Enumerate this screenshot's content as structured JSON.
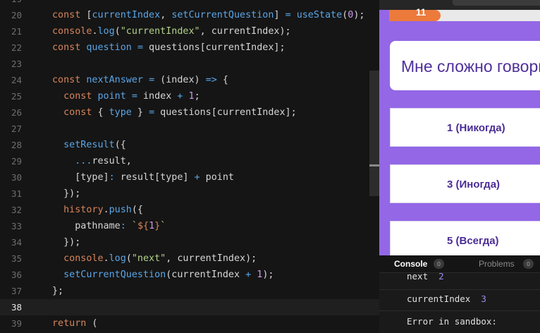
{
  "editor": {
    "top_partial_line": "19",
    "line_numbers": [
      "20",
      "21",
      "22",
      "23",
      "24",
      "25",
      "26",
      "27",
      "28",
      "29",
      "30",
      "31",
      "32",
      "33",
      "34",
      "35",
      "36",
      "37",
      "38",
      "39"
    ],
    "lines": [
      [
        [
          "kw",
          "const"
        ],
        [
          "pl",
          " ["
        ],
        [
          "fn",
          "currentIndex"
        ],
        [
          "pl",
          ", "
        ],
        [
          "fn",
          "setCurrentQuestion"
        ],
        [
          "pl",
          "] "
        ],
        [
          "op",
          "="
        ],
        [
          "pl",
          " "
        ],
        [
          "fn",
          "useState"
        ],
        [
          "pl",
          "("
        ],
        [
          "num",
          "0"
        ],
        [
          "pl",
          ");"
        ]
      ],
      [
        [
          "kw",
          "console"
        ],
        [
          "pl",
          "."
        ],
        [
          "fn",
          "log"
        ],
        [
          "pl",
          "("
        ],
        [
          "str",
          "\"currentIndex\""
        ],
        [
          "pl",
          ", currentIndex);"
        ]
      ],
      [
        [
          "kw",
          "const"
        ],
        [
          "pl",
          " "
        ],
        [
          "fn",
          "question"
        ],
        [
          "pl",
          " "
        ],
        [
          "op",
          "="
        ],
        [
          "pl",
          " questions[currentIndex];"
        ]
      ],
      [],
      [
        [
          "kw",
          "const"
        ],
        [
          "pl",
          " "
        ],
        [
          "fn",
          "nextAnswer"
        ],
        [
          "pl",
          " "
        ],
        [
          "op",
          "="
        ],
        [
          "pl",
          " (index) "
        ],
        [
          "op",
          "=>"
        ],
        [
          "pl",
          " {"
        ]
      ],
      [
        [
          "pl",
          "  "
        ],
        [
          "kw",
          "const"
        ],
        [
          "pl",
          " "
        ],
        [
          "fn",
          "point"
        ],
        [
          "pl",
          " "
        ],
        [
          "op",
          "="
        ],
        [
          "pl",
          " index "
        ],
        [
          "op",
          "+"
        ],
        [
          "pl",
          " "
        ],
        [
          "num",
          "1"
        ],
        [
          "pl",
          ";"
        ]
      ],
      [
        [
          "pl",
          "  "
        ],
        [
          "kw",
          "const"
        ],
        [
          "pl",
          " { "
        ],
        [
          "fn",
          "type"
        ],
        [
          "pl",
          " } "
        ],
        [
          "op",
          "="
        ],
        [
          "pl",
          " questions[currentIndex];"
        ]
      ],
      [],
      [
        [
          "pl",
          "  "
        ],
        [
          "fn",
          "setResult"
        ],
        [
          "pl",
          "({"
        ]
      ],
      [
        [
          "pl",
          "    "
        ],
        [
          "op",
          "..."
        ],
        [
          "pl",
          "result,"
        ]
      ],
      [
        [
          "pl",
          "    [type]"
        ],
        [
          "op",
          ":"
        ],
        [
          "pl",
          " result[type] "
        ],
        [
          "op",
          "+"
        ],
        [
          "pl",
          " point"
        ]
      ],
      [
        [
          "pl",
          "  });"
        ]
      ],
      [
        [
          "pl",
          "  "
        ],
        [
          "kw",
          "history"
        ],
        [
          "pl",
          "."
        ],
        [
          "fn",
          "push"
        ],
        [
          "pl",
          "({"
        ]
      ],
      [
        [
          "pl",
          "    pathname"
        ],
        [
          "op",
          ":"
        ],
        [
          "pl",
          " "
        ],
        [
          "str",
          "`"
        ],
        [
          "kw",
          "${"
        ],
        [
          "num",
          "1"
        ],
        [
          "kw",
          "}"
        ],
        [
          "str",
          "`"
        ]
      ],
      [
        [
          "pl",
          "  });"
        ]
      ],
      [
        [
          "pl",
          "  "
        ],
        [
          "kw",
          "console"
        ],
        [
          "pl",
          "."
        ],
        [
          "fn",
          "log"
        ],
        [
          "pl",
          "("
        ],
        [
          "str",
          "\"next\""
        ],
        [
          "pl",
          ", currentIndex);"
        ]
      ],
      [
        [
          "pl",
          "  "
        ],
        [
          "fn",
          "setCurrentQuestion"
        ],
        [
          "pl",
          "(currentIndex "
        ],
        [
          "op",
          "+"
        ],
        [
          "pl",
          " "
        ],
        [
          "num",
          "1"
        ],
        [
          "pl",
          ");"
        ]
      ],
      [
        [
          "pl",
          "};"
        ]
      ],
      [],
      [
        [
          "kw",
          "return"
        ],
        [
          "pl",
          " ("
        ]
      ]
    ],
    "active_line": 18
  },
  "preview": {
    "progress_count": "11",
    "progress_fraction": 0.34,
    "question": "Мне сложно говорить",
    "answers": [
      "1 (Никогда)",
      "3 (Иногда)",
      "5 (Всегда)"
    ]
  },
  "console": {
    "tabs": [
      {
        "label": "Console",
        "count": "0"
      },
      {
        "label": "Problems",
        "count": "0"
      }
    ],
    "logs": [
      {
        "key": "next",
        "value": "2"
      },
      {
        "key": "currentIndex",
        "value": "3"
      },
      {
        "key": "Error in sandbox:",
        "value": ""
      }
    ]
  },
  "colors": {
    "editor_bg": "#151515",
    "preview_bg": "#9367e6",
    "accent_orange": "#ec7a3b",
    "question_text": "#4f2f9a"
  }
}
